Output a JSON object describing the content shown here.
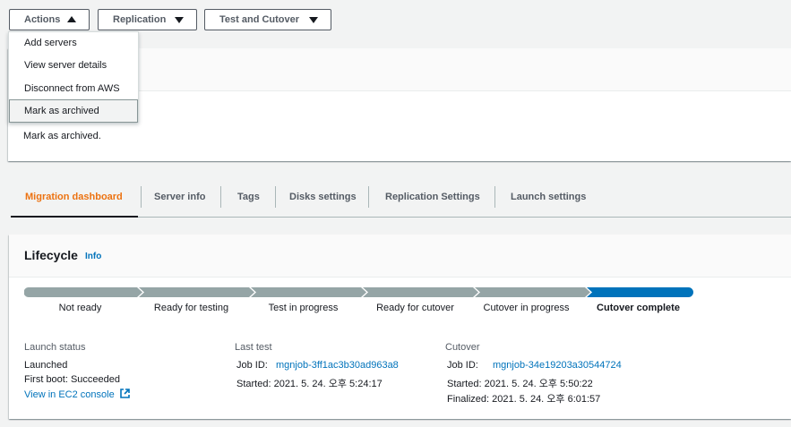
{
  "toolbar": {
    "actions_label": "Actions",
    "replication_label": "Replication",
    "test_cutover_label": "Test and Cutover"
  },
  "actions_menu": {
    "items": [
      {
        "label": "Add servers"
      },
      {
        "label": "View server details"
      },
      {
        "label": "Disconnect from AWS"
      },
      {
        "label": "Mark as archived"
      }
    ]
  },
  "notice": {
    "text": "Mark as archived."
  },
  "tabs": [
    {
      "label": "Migration dashboard"
    },
    {
      "label": "Server info"
    },
    {
      "label": "Tags"
    },
    {
      "label": "Disks settings"
    },
    {
      "label": "Replication Settings"
    },
    {
      "label": "Launch settings"
    }
  ],
  "lifecycle": {
    "title": "Lifecycle",
    "info_label": "Info",
    "stages": [
      {
        "label": "Not ready"
      },
      {
        "label": "Ready for testing"
      },
      {
        "label": "Test in progress"
      },
      {
        "label": "Ready for cutover"
      },
      {
        "label": "Cutover in progress"
      },
      {
        "label": "Cutover complete"
      }
    ],
    "current_stage": "Cutover complete",
    "colors": {
      "completed": "#95a5a6",
      "current": "#0073bb"
    }
  },
  "launch_status": {
    "title": "Launch status",
    "state": "Launched",
    "first_boot": "First boot: Succeeded",
    "link": "View in EC2 console"
  },
  "last_test": {
    "title": "Last test",
    "job_label": "Job ID:",
    "job_id": "mgnjob-3ff1ac3b30ad963a8",
    "started": "Started: 2021. 5. 24. 오후 5:24:17"
  },
  "cutover": {
    "title": "Cutover",
    "job_label": "Job ID:",
    "job_id": "mgnjob-34e19203a30544724",
    "started": "Started: 2021. 5. 24. 오후 5:50:22",
    "finalized": "Finalized: 2021. 5. 24. 오후 6:01:57"
  }
}
